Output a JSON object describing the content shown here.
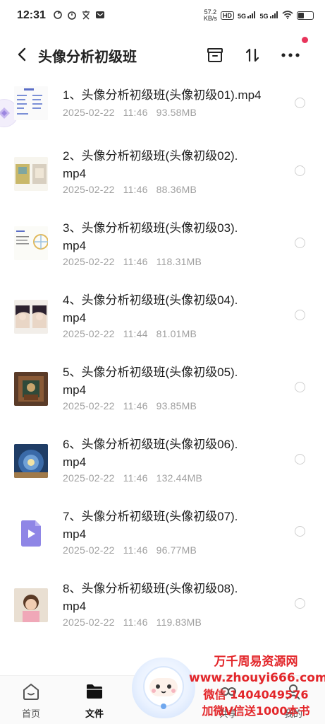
{
  "status_bar": {
    "time": "12:31",
    "net_speed_value": "57.2",
    "net_speed_unit": "KB/s",
    "hd_label": "HD",
    "sig1_label": "5G",
    "sig2_label": "5G",
    "battery_level": 0.35
  },
  "header": {
    "title": "头像分析初级班"
  },
  "files": [
    {
      "name": "1、头像分析初级班(头像初级01).mp4",
      "date": "2025-02-22",
      "time": "11:46",
      "size": "93.58MB"
    },
    {
      "name": "2、头像分析初级班(头像初级02).mp4",
      "date": "2025-02-22",
      "time": "11:46",
      "size": "88.36MB"
    },
    {
      "name": "3、头像分析初级班(头像初级03).mp4",
      "date": "2025-02-22",
      "time": "11:46",
      "size": "118.31MB"
    },
    {
      "name": "4、头像分析初级班(头像初级04).mp4",
      "date": "2025-02-22",
      "time": "11:44",
      "size": "81.01MB"
    },
    {
      "name": "5、头像分析初级班(头像初级05).mp4",
      "date": "2025-02-22",
      "time": "11:46",
      "size": "93.85MB"
    },
    {
      "name": "6、头像分析初级班(头像初级06).mp4",
      "date": "2025-02-22",
      "time": "11:46",
      "size": "132.44MB"
    },
    {
      "name": "7、头像分析初级班(头像初级07).mp4",
      "date": "2025-02-22",
      "time": "11:46",
      "size": "96.77MB"
    },
    {
      "name": "8、头像分析初级班(头像初级08).mp4",
      "date": "2025-02-22",
      "time": "11:46",
      "size": "119.83MB"
    }
  ],
  "bottom_nav": {
    "home_label": "首页",
    "files_label": "文件",
    "share_label": "共享",
    "mine_label": "我的"
  },
  "watermark": {
    "line1": "万千周易资源网",
    "line2": "www.zhouyi666.com",
    "line3": "微信 1404049576",
    "line4": "加微V信送1000本书"
  },
  "colors": {
    "accent_red": "#e8345b",
    "watermark_red": "#e3262a",
    "meta_gray": "#a0a0a0"
  }
}
